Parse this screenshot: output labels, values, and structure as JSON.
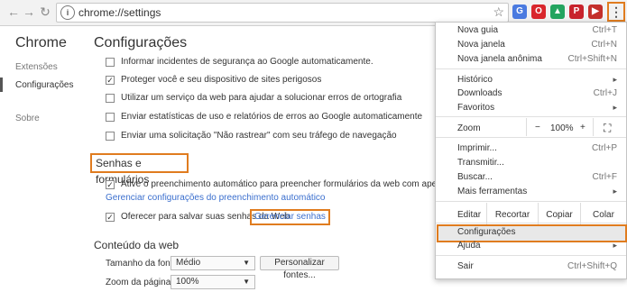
{
  "browser": {
    "url": "chrome://settings",
    "info_icon": "i",
    "star_icon": "☆",
    "menu_icon": "⋮"
  },
  "extensions": [
    {
      "icon": "translate-icon",
      "glyph": "G",
      "color": "#4a7ae0"
    },
    {
      "icon": "opera-icon",
      "glyph": "O",
      "color": "#d9262c"
    },
    {
      "icon": "drive-icon",
      "glyph": "▲",
      "color": "#23a45f"
    },
    {
      "icon": "pinterest-icon",
      "glyph": "P",
      "color": "#c8232c"
    },
    {
      "icon": "youtube-icon",
      "glyph": "▶",
      "color": "#c4302b"
    },
    {
      "icon": "extension-icon",
      "glyph": "◫",
      "color": "#9e9e9e"
    },
    {
      "icon": "copy-icon",
      "glyph": "⧉",
      "color": "#9e9e9e"
    }
  ],
  "sidebar": {
    "title": "Chrome",
    "items": [
      {
        "label": "Extensões"
      },
      {
        "label": "Configurações"
      },
      {
        "label": "Sobre"
      }
    ]
  },
  "main": {
    "title": "Configurações",
    "privacy_rows": [
      {
        "label": "Informar incidentes de segurança ao Google automaticamente.",
        "checked": false
      },
      {
        "label": "Proteger você e seu dispositivo de sites perigosos",
        "checked": true
      },
      {
        "label": "Utilizar um serviço da web para ajudar a solucionar erros de ortografia",
        "checked": false
      },
      {
        "label": "Enviar estatísticas de uso e relatórios de erros ao Google automaticamente",
        "checked": false
      },
      {
        "label": "Enviar uma solicitação \"Não rastrear\" com seu tráfego de navegação",
        "checked": false
      }
    ],
    "passwords": {
      "title": "Senhas e formulários",
      "autofill_label": "Ative o preenchimento automático para preencher formulários da web com apenas um clique.",
      "autofill_link": "Gerenciar configurações do preenchimento automático",
      "save_label": "Oferecer para salvar suas senhas da Web",
      "manage_link": "Gerenciar senhas"
    },
    "web_content": {
      "title": "Conteúdo da web",
      "font_size_label": "Tamanho da fonte:",
      "font_size_value": "Médio",
      "customize_fonts": "Personalizar fontes...",
      "zoom_label": "Zoom da página:",
      "zoom_value": "100%"
    }
  },
  "menu": {
    "new_tab": "Nova guia",
    "new_tab_sc": "Ctrl+T",
    "new_window": "Nova janela",
    "new_window_sc": "Ctrl+N",
    "incognito": "Nova janela anônima",
    "incognito_sc": "Ctrl+Shift+N",
    "history": "Histórico",
    "downloads": "Downloads",
    "downloads_sc": "Ctrl+J",
    "bookmarks": "Favoritos",
    "zoom": "Zoom",
    "zoom_minus": "−",
    "zoom_value": "100%",
    "zoom_plus": "+",
    "fullscreen_icon": "⛶",
    "print": "Imprimir...",
    "print_sc": "Ctrl+P",
    "cast": "Transmitir...",
    "find": "Buscar...",
    "find_sc": "Ctrl+F",
    "more_tools": "Mais ferramentas",
    "edit": "Editar",
    "cut": "Recortar",
    "copy": "Copiar",
    "paste": "Colar",
    "settings": "Configurações",
    "help": "Ajuda",
    "exit": "Sair",
    "exit_sc": "Ctrl+Shift+Q",
    "submenu_arrow": "▸"
  },
  "colors": {
    "highlight": "#e07c1f",
    "link": "#3b6fce"
  }
}
